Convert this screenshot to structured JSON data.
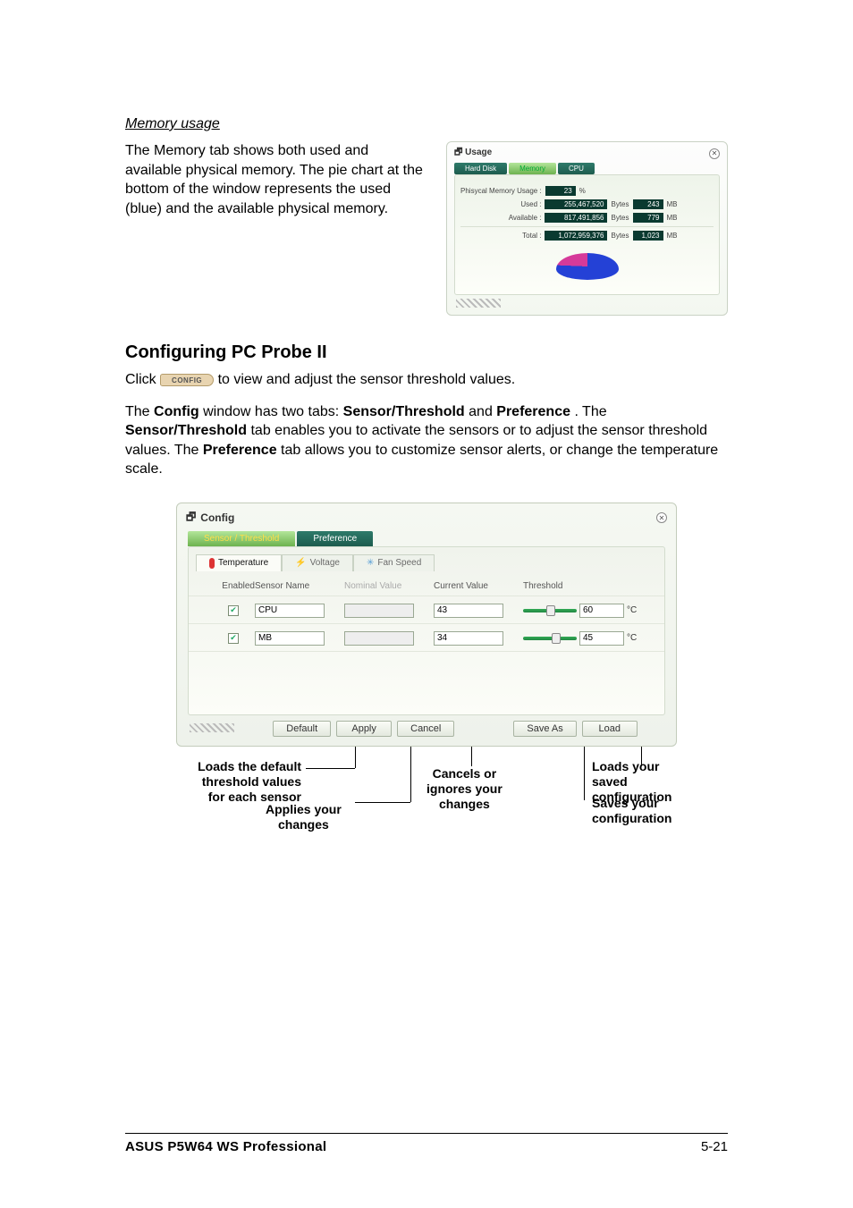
{
  "section": {
    "mem_usage_title": "Memory usage"
  },
  "paragraphs": {
    "mem_usage": "The Memory tab shows both used and available physical memory. The pie chart at the bottom of the window represents the used (blue) and the available physical memory.",
    "config_heading": "Configuring PC Probe II",
    "config_click_before": "Click ",
    "config_click_after": " to view and adjust the sensor threshold values.",
    "config_btn_text": "CONFIG",
    "config_para_1a": "The ",
    "config_para_1b": " window has two tabs: ",
    "config_para_1c": " and ",
    "config_para_1d": ". The ",
    "config_para_1e": " tab enables you to activate the sensors or to adjust the sensor threshold values. The ",
    "config_para_1f": " tab allows you to customize sensor alerts, or change the temperature scale.",
    "bold_config": "Config",
    "bold_sensor_threshold": "Sensor/Threshold",
    "bold_preference": "Preference"
  },
  "usage_panel": {
    "title": "Usage",
    "tabs": {
      "hard_disk": "Hard Disk",
      "memory": "Memory",
      "cpu": "CPU"
    },
    "headline_label": "Phisycal Memory Usage :",
    "headline_value": "23",
    "headline_unit": "%",
    "rows": {
      "used": {
        "label": "Used :",
        "bytes": "255,467,520",
        "bytes_unit": "Bytes",
        "mb": "243",
        "mb_unit": "MB"
      },
      "available": {
        "label": "Available :",
        "bytes": "817,491,856",
        "bytes_unit": "Bytes",
        "mb": "779",
        "mb_unit": "MB"
      },
      "total": {
        "label": "Total :",
        "bytes": "1,072,959,376",
        "bytes_unit": "Bytes",
        "mb": "1,023",
        "mb_unit": "MB"
      }
    }
  },
  "config_panel": {
    "title": "Config",
    "top_tabs": {
      "sensor": "Sensor / Threshold",
      "preference": "Preference"
    },
    "sub_tabs": {
      "temperature": "Temperature",
      "voltage": "Voltage",
      "fan": "Fan Speed"
    },
    "headers": {
      "enabled": "Enabled",
      "sensor_name": "Sensor Name",
      "nominal": "Nominal Value",
      "current": "Current Value",
      "threshold": "Threshold"
    },
    "rows": [
      {
        "enabled": true,
        "name": "CPU",
        "nominal": "",
        "current": "43",
        "threshold": "60",
        "unit": "°C"
      },
      {
        "enabled": true,
        "name": "MB",
        "nominal": "",
        "current": "34",
        "threshold": "45",
        "unit": "°C"
      }
    ],
    "buttons": {
      "default": "Default",
      "apply": "Apply",
      "cancel": "Cancel",
      "save_as": "Save As",
      "load": "Load"
    }
  },
  "callouts": {
    "default": "Loads the default\nthreshold values\nfor each sensor",
    "apply": "Applies your\nchanges",
    "cancel": "Cancels or\nignores your\nchanges",
    "load": "Loads your saved\nconfiguration",
    "save": "Saves your\nconfiguration"
  },
  "footer": {
    "left": "ASUS P5W64 WS Professional",
    "right": "5-21"
  }
}
